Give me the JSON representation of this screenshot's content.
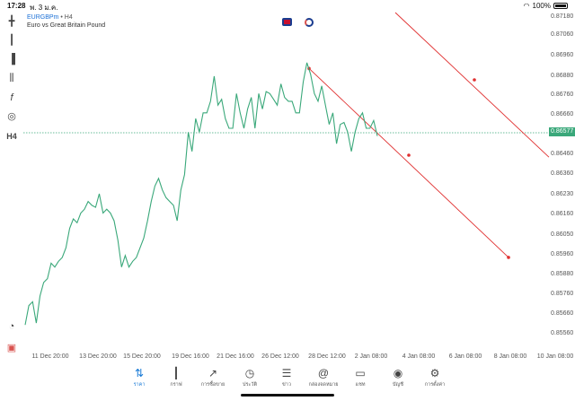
{
  "status_bar": {
    "time": "17:28",
    "date": "พ. 3 ม.ค.",
    "wifi_icon": "wifi-icon",
    "battery": "100%"
  },
  "header": {
    "symbol": "EURGBPm",
    "separator": "•",
    "timeframe": "H4",
    "description": "Euro vs Great Britain Pound"
  },
  "toolbar": {
    "icons": [
      "crosshair-icon",
      "candlestick-icon",
      "indicator-icon",
      "settings-sliders-icon",
      "function-icon",
      "shapes-icon",
      "timeframe-icon"
    ],
    "timeframe_label": "H4"
  },
  "bottom_nav": {
    "items": [
      {
        "label": "ราคา",
        "icon": "quotes-arrows-icon",
        "active": true
      },
      {
        "label": "กราฟ",
        "icon": "chart-candles-icon",
        "active": false
      },
      {
        "label": "การซื้อขาย",
        "icon": "trade-chart-icon",
        "active": false
      },
      {
        "label": "ประวัติ",
        "icon": "history-clock-icon",
        "active": false
      },
      {
        "label": "ข่าว",
        "icon": "news-icon",
        "active": false
      },
      {
        "label": "กล่องจดหมาย",
        "icon": "mail-at-icon",
        "active": false
      },
      {
        "label": "แชท",
        "icon": "chat-bubble-icon",
        "active": false
      },
      {
        "label": "บัญชี",
        "icon": "account-icon",
        "active": false
      },
      {
        "label": "การตั้งค่า",
        "icon": "gear-icon",
        "active": false
      }
    ]
  },
  "colors": {
    "line": "#3aa87a",
    "trendline": "#e03030",
    "accent": "#1a7bd6"
  },
  "chart_data": {
    "type": "line",
    "symbol": "EURGBPm",
    "timeframe": "H4",
    "y_ticks": [
      "0.87180",
      "0.87060",
      "0.86960",
      "0.86880",
      "0.86760",
      "0.86660",
      "0.86577",
      "0.86460",
      "0.86360",
      "0.86230",
      "0.86160",
      "0.86050",
      "0.85960",
      "0.85880",
      "0.85760",
      "0.85660",
      "0.85560"
    ],
    "current_price": "0.86577",
    "x_ticks": [
      "11 Dec 20:00",
      "13 Dec 20:00",
      "15 Dec 20:00",
      "19 Dec 16:00",
      "21 Dec 16:00",
      "26 Dec 12:00",
      "28 Dec 12:00",
      "2 Jan 08:00",
      "4 Jan 08:00",
      "6 Jan 08:00",
      "8 Jan 08:00",
      "10 Jan 08:00"
    ],
    "ylim": [
      0.8548,
      0.8722
    ],
    "series": [
      {
        "values": [
          0.856,
          0.857,
          0.8572,
          0.8561,
          0.8575,
          0.8582,
          0.8584,
          0.8592,
          0.859,
          0.8593,
          0.8595,
          0.86,
          0.861,
          0.8615,
          0.8613,
          0.8618,
          0.862,
          0.8624,
          0.8622,
          0.8621,
          0.8628,
          0.8618,
          0.862,
          0.8618,
          0.8614,
          0.8604,
          0.859,
          0.8596,
          0.859,
          0.8593,
          0.8595,
          0.86,
          0.8605,
          0.8614,
          0.8624,
          0.8632,
          0.8636,
          0.863,
          0.8626,
          0.8624,
          0.8622,
          0.8614,
          0.863,
          0.8638,
          0.866,
          0.865,
          0.8667,
          0.866,
          0.867,
          0.867,
          0.8676,
          0.8689,
          0.8674,
          0.8677,
          0.8667,
          0.8662,
          0.8662,
          0.868,
          0.867,
          0.8662,
          0.8672,
          0.8678,
          0.8662,
          0.868,
          0.8672,
          0.8681,
          0.868,
          0.8677,
          0.8674,
          0.8685,
          0.8678,
          0.8676,
          0.8676,
          0.867,
          0.867,
          0.8686,
          0.8696,
          0.869,
          0.868,
          0.8676,
          0.8684,
          0.8674,
          0.8664,
          0.867,
          0.8654,
          0.8664,
          0.8665,
          0.866,
          0.865,
          0.866,
          0.8667,
          0.867,
          0.8662,
          0.8662,
          0.8666,
          0.8658
        ]
      }
    ],
    "trendlines": [
      {
        "name": "trendline-lower",
        "points": [
          [
            0.8693,
            "28 Dec 04:00"
          ],
          [
            0.8595,
            "8 Jan 08:00"
          ]
        ]
      },
      {
        "name": "trendline-upper",
        "points": [
          [
            0.8722,
            "28 Dec 16:00"
          ],
          [
            0.8647,
            "10 Jan 08:00"
          ]
        ]
      }
    ],
    "grid": false,
    "legend": "none"
  }
}
